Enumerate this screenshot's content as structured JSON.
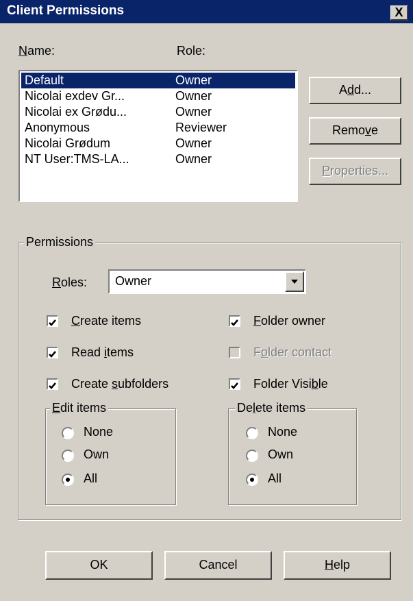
{
  "window": {
    "title": "Client Permissions",
    "close_glyph": "X"
  },
  "list": {
    "name_header": [
      "N",
      "ame:"
    ],
    "role_header": "Role:",
    "rows": [
      {
        "name": "Default",
        "role": "Owner"
      },
      {
        "name": "Nicolai exdev Gr...",
        "role": "Owner"
      },
      {
        "name": "Nicolai ex Grødu...",
        "role": "Owner"
      },
      {
        "name": "Anonymous",
        "role": "Reviewer"
      },
      {
        "name": "Nicolai Grødum",
        "role": "Owner"
      },
      {
        "name": "NT User:TMS-LA...",
        "role": "Owner"
      }
    ]
  },
  "buttons": {
    "add": [
      "A",
      "d",
      "d..."
    ],
    "remove": [
      "Remo",
      "v",
      "e"
    ],
    "properties": [
      "",
      "P",
      "roperties..."
    ],
    "ok": "OK",
    "cancel": "Cancel",
    "help": [
      "",
      "H",
      "elp"
    ]
  },
  "permissions": {
    "legend": "Permissions",
    "roles_label": [
      "",
      "R",
      "oles:"
    ],
    "roles_value": "Owner",
    "create_items": {
      "label": [
        "",
        "C",
        "reate items"
      ],
      "checked": true
    },
    "read_items": {
      "label": [
        "Read ",
        "i",
        "tems"
      ],
      "checked": true
    },
    "create_subfolders": {
      "label": [
        "Create ",
        "s",
        "ubfolders"
      ],
      "checked": true
    },
    "folder_owner": {
      "label": [
        "",
        "F",
        "older owner"
      ],
      "checked": true
    },
    "folder_contact": {
      "label": [
        "F",
        "o",
        "lder contact"
      ],
      "checked": false,
      "disabled": true
    },
    "folder_visible": {
      "label": [
        "Folder Visi",
        "b",
        "le"
      ],
      "checked": true
    },
    "edit_items": {
      "legend": [
        "",
        "E",
        "dit items"
      ],
      "options": [
        "None",
        "Own",
        "All"
      ],
      "selected": "All"
    },
    "delete_items": {
      "legend": [
        "De",
        "l",
        "ete items"
      ],
      "options": [
        "None",
        "Own",
        "All"
      ],
      "selected": "All"
    }
  },
  "colors": {
    "titlebar": "#0a246a",
    "face": "#d4d0c8",
    "selection": "#0a246a"
  }
}
